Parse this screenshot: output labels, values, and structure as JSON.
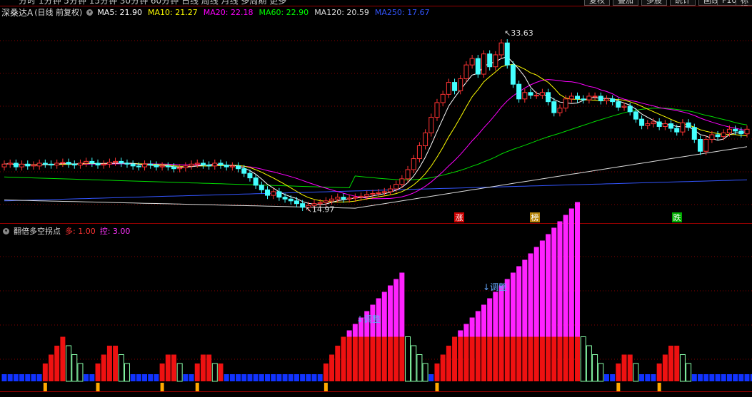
{
  "topbar": {
    "periods_text": "分时 1分钟 5分钟 15分钟 30分钟 60分钟 日线 周线 月线 多周期 更多",
    "buttons": [
      "复权",
      "叠加",
      "多股",
      "统计",
      "画线",
      "F10",
      "标记"
    ]
  },
  "price_panel": {
    "stock_name": "深桑达A",
    "mode": "(日线 前复权)",
    "ma_labels": [
      {
        "text": "MA5: 21.90",
        "color": "#ffffff"
      },
      {
        "text": "MA10: 21.27",
        "color": "#ffff00"
      },
      {
        "text": "MA20: 22.18",
        "color": "#ff00ff"
      },
      {
        "text": "MA60: 22.90",
        "color": "#00ff00"
      },
      {
        "text": "MA120: 20.59",
        "color": "#dddddd"
      },
      {
        "text": "MA250: 17.67",
        "color": "#3355ff"
      }
    ],
    "high_label": "33.63",
    "low_label": "14.97",
    "markers": [
      {
        "text": "涨",
        "bg": "#cc0000",
        "fg": "#ffffff"
      },
      {
        "text": "榜",
        "bg": "#b8860b",
        "fg": "#ffffff"
      },
      {
        "text": "跌",
        "bg": "#00aa00",
        "fg": "#ffffff"
      }
    ]
  },
  "indicator_panel": {
    "name": "翻倍多空拐点",
    "duo_label": "多: 1.00",
    "kong_label": "控: 3.00",
    "annotation": "↓调整",
    "colors": {
      "bull": "#ee1111",
      "bear": "#88ffaa",
      "blue": "#1133ff",
      "magenta": "#ff22ff",
      "marker": "#ffaa00"
    }
  },
  "chart_data": {
    "type": "candlestick",
    "ylim": [
      14.0,
      35.5
    ],
    "closes": [
      19.8,
      19.9,
      19.5,
      19.8,
      19.6,
      19.7,
      19.9,
      19.8,
      19.7,
      19.9,
      20.0,
      19.8,
      19.7,
      19.9,
      20.1,
      19.9,
      19.7,
      19.8,
      20.0,
      20.1,
      19.9,
      19.8,
      19.6,
      19.5,
      19.8,
      19.7,
      19.5,
      19.6,
      19.5,
      19.3,
      19.4,
      19.6,
      19.8,
      19.9,
      19.7,
      19.6,
      19.9,
      19.7,
      19.5,
      19.6,
      19.3,
      18.8,
      18.3,
      17.5,
      17.0,
      16.4,
      16.8,
      16.2,
      16.0,
      15.8,
      15.5,
      15.1,
      15.3,
      15.5,
      15.6,
      15.8,
      16.0,
      16.2,
      16.0,
      16.1,
      16.2,
      16.3,
      16.5,
      16.6,
      16.7,
      16.8,
      17.1,
      17.6,
      18.2,
      19.2,
      20.4,
      21.8,
      23.2,
      24.9,
      26.5,
      27.4,
      28.7,
      27.8,
      29.1,
      30.6,
      31.3,
      29.6,
      31.8,
      30.4,
      31.7,
      33.0,
      30.6,
      28.5,
      26.9,
      27.6,
      27.3,
      27.3,
      27.6,
      26.6,
      25.4,
      25.9,
      26.9,
      27.2,
      26.9,
      26.8,
      27.2,
      27.2,
      26.7,
      26.9,
      26.6,
      26.0,
      26.1,
      25.5,
      24.7,
      24.0,
      24.2,
      24.4,
      23.9,
      24.2,
      23.7,
      23.3,
      24.3,
      23.8,
      22.5,
      21.2,
      22.5,
      23.0,
      22.8,
      23.2,
      23.6,
      23.4,
      23.1,
      23.6
    ],
    "opens": [
      19.5,
      19.8,
      19.9,
      19.5,
      19.8,
      19.6,
      19.6,
      19.9,
      19.8,
      19.7,
      19.9,
      20.0,
      19.8,
      19.7,
      19.9,
      20.1,
      19.9,
      19.7,
      19.8,
      20.0,
      20.1,
      19.9,
      19.8,
      19.6,
      19.5,
      19.8,
      19.7,
      19.5,
      19.6,
      19.5,
      19.3,
      19.4,
      19.6,
      19.8,
      19.9,
      19.7,
      19.6,
      19.9,
      19.7,
      19.5,
      19.6,
      19.3,
      18.8,
      18.3,
      17.5,
      17.0,
      16.4,
      16.8,
      16.2,
      16.0,
      15.8,
      15.5,
      15.1,
      15.3,
      15.5,
      15.6,
      15.8,
      16.0,
      16.2,
      16.0,
      16.1,
      16.2,
      16.3,
      16.5,
      16.6,
      16.7,
      16.8,
      17.1,
      17.6,
      18.2,
      19.2,
      20.4,
      21.8,
      23.2,
      24.9,
      26.5,
      27.4,
      28.7,
      27.8,
      29.1,
      30.6,
      31.3,
      29.6,
      31.8,
      30.4,
      31.7,
      33.0,
      30.6,
      28.5,
      26.9,
      27.6,
      27.3,
      27.3,
      27.6,
      26.6,
      25.4,
      25.9,
      26.9,
      27.2,
      26.9,
      26.8,
      27.2,
      27.2,
      26.7,
      26.9,
      26.6,
      26.0,
      26.1,
      25.5,
      24.7,
      24.0,
      24.2,
      24.4,
      23.9,
      24.2,
      23.7,
      23.3,
      24.3,
      23.8,
      22.5,
      21.2,
      22.5,
      23.0,
      22.8,
      23.2,
      23.6,
      23.4,
      23.1
    ],
    "indicator": [
      1,
      1,
      1,
      1,
      1,
      1,
      1,
      2,
      3,
      4,
      5,
      4,
      3,
      2,
      1,
      1,
      2,
      3,
      4,
      4,
      3,
      2,
      1,
      1,
      1,
      1,
      1,
      2,
      3,
      3,
      2,
      1,
      1,
      2,
      3,
      3,
      2,
      2,
      1,
      1,
      1,
      1,
      1,
      1,
      1,
      1,
      1,
      1,
      1,
      1,
      1,
      1,
      1,
      1,
      1,
      2,
      3,
      4,
      5,
      6,
      7,
      8,
      9,
      10,
      11,
      12,
      13,
      14,
      15,
      5,
      4,
      3,
      2,
      1,
      2,
      3,
      4,
      5,
      6,
      7,
      8,
      9,
      10,
      11,
      12,
      13,
      14,
      15,
      16,
      17,
      18,
      19,
      20,
      21,
      22,
      23,
      24,
      25,
      26,
      5,
      4,
      3,
      2,
      1,
      1,
      2,
      3,
      3,
      2,
      1,
      1,
      1,
      2,
      3,
      4,
      4,
      3,
      2,
      1,
      1,
      1,
      1,
      1,
      1,
      1,
      1,
      1,
      1,
      1,
      1,
      1,
      2,
      3,
      3,
      2,
      1,
      2,
      3,
      4,
      4
    ],
    "indicator_note": "heights in relative units; >5 portions drawn magenta above red base"
  }
}
